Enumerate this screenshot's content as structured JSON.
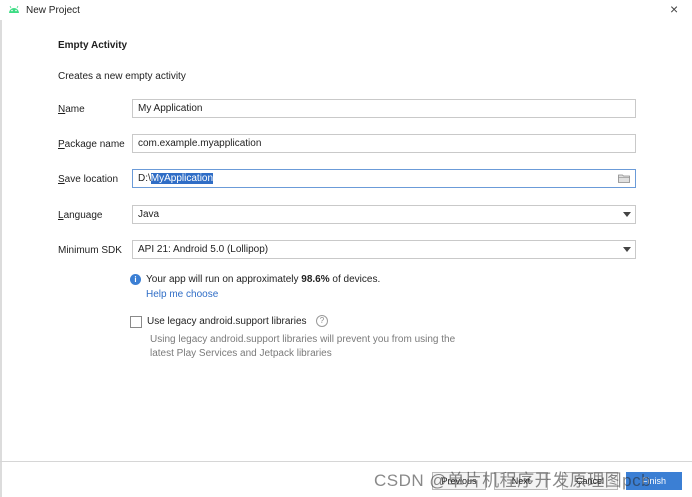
{
  "window": {
    "title": "New Project",
    "close_glyph": "×"
  },
  "page": {
    "heading": "Empty Activity",
    "description": "Creates a new empty activity"
  },
  "form": {
    "name": {
      "label_mnemonic": "N",
      "label_rest": "ame",
      "value": "My Application"
    },
    "package": {
      "label_mnemonic": "P",
      "label_rest": "ackage name",
      "value": "com.example.myapplication"
    },
    "save_location": {
      "label_mnemonic": "S",
      "label_rest": "ave location",
      "value_prefix": "D:\\",
      "value_selected": "MyApplication"
    },
    "language": {
      "label_mnemonic": "L",
      "label_rest": "anguage",
      "value": "Java"
    },
    "min_sdk": {
      "label": "Minimum SDK",
      "value": "API 21: Android 5.0 (Lollipop)"
    }
  },
  "info": {
    "text_before": "Your app will run on approximately ",
    "percent": "98.6%",
    "text_after": " of devices.",
    "help_link": "Help me choose"
  },
  "legacy": {
    "checked": false,
    "label": "Use legacy android.support libraries",
    "description": "Using legacy android.support libraries will prevent you from using the latest Play Services and Jetpack libraries"
  },
  "buttons": {
    "previous": "Previous",
    "next": "Next",
    "cancel": "Cancel",
    "finish": "Finish"
  },
  "watermark": "CSDN @单片机程序开发原理图pcb",
  "icons": {
    "app": "android-icon",
    "info": "info-icon",
    "help": "question-icon",
    "folder": "folder-icon",
    "dropdown": "chevron-down-icon"
  },
  "colors": {
    "accent": "#2f6dc6",
    "primary_button": "#3b7fd4",
    "muted_text": "#7a7a7a"
  }
}
